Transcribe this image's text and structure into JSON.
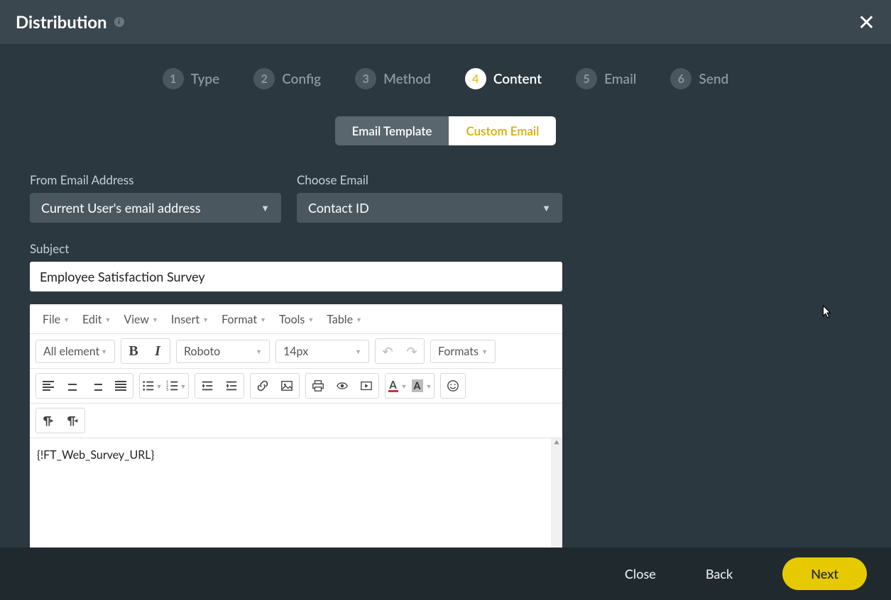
{
  "header": {
    "title": "Distribution"
  },
  "steps": [
    {
      "num": "1",
      "label": "Type"
    },
    {
      "num": "2",
      "label": "Config"
    },
    {
      "num": "3",
      "label": "Method"
    },
    {
      "num": "4",
      "label": "Content"
    },
    {
      "num": "5",
      "label": "Email"
    },
    {
      "num": "6",
      "label": "Send"
    }
  ],
  "active_step": 4,
  "toggle": {
    "template": "Email Template",
    "custom": "Custom Email",
    "active": "custom"
  },
  "form": {
    "from_label": "From Email Address",
    "from_value": "Current User's email address",
    "choose_label": "Choose Email",
    "choose_value": "Contact ID",
    "subject_label": "Subject",
    "subject_value": "Employee Satisfaction Survey"
  },
  "editor": {
    "menus": {
      "file": "File",
      "edit": "Edit",
      "view": "View",
      "insert": "Insert",
      "format": "Format",
      "tools": "Tools",
      "table": "Table"
    },
    "element_dd": "All element",
    "font_dd": "Roboto",
    "size_dd": "14px",
    "formats_dd": "Formats",
    "body": "{!FT_Web_Survey_URL}"
  },
  "footer": {
    "close": "Close",
    "back": "Back",
    "next": "Next"
  }
}
